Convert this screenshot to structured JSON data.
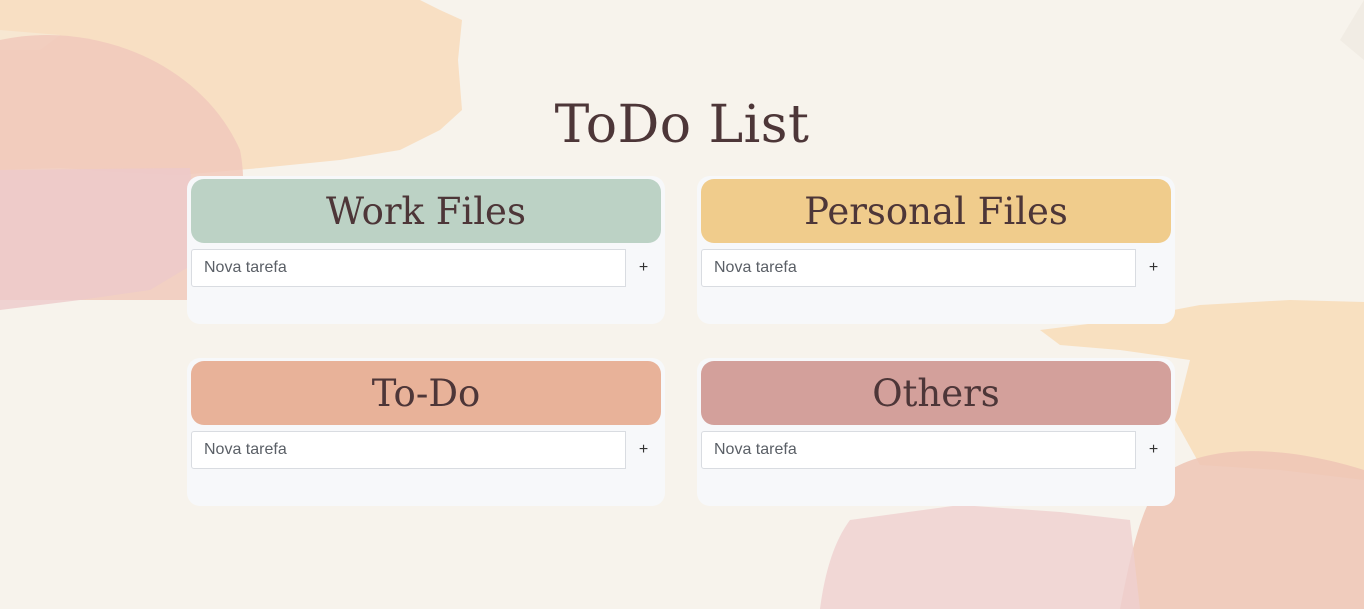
{
  "page": {
    "title": "ToDo List"
  },
  "lists": [
    {
      "title": "Work Files",
      "color": "#bcd2c5",
      "input_placeholder": "Nova tarefa",
      "add_label": "+"
    },
    {
      "title": "Personal Files",
      "color": "#f0cc8c",
      "input_placeholder": "Nova tarefa",
      "add_label": "+"
    },
    {
      "title": "To-Do",
      "color": "#e8b299",
      "input_placeholder": "Nova tarefa",
      "add_label": "+"
    },
    {
      "title": "Others",
      "color": "#d3a09b",
      "input_placeholder": "Nova tarefa",
      "add_label": "+"
    }
  ],
  "colors": {
    "text": "#4d3638",
    "card_background": "#f7f8fa",
    "page_background": "#f7f3ec"
  }
}
